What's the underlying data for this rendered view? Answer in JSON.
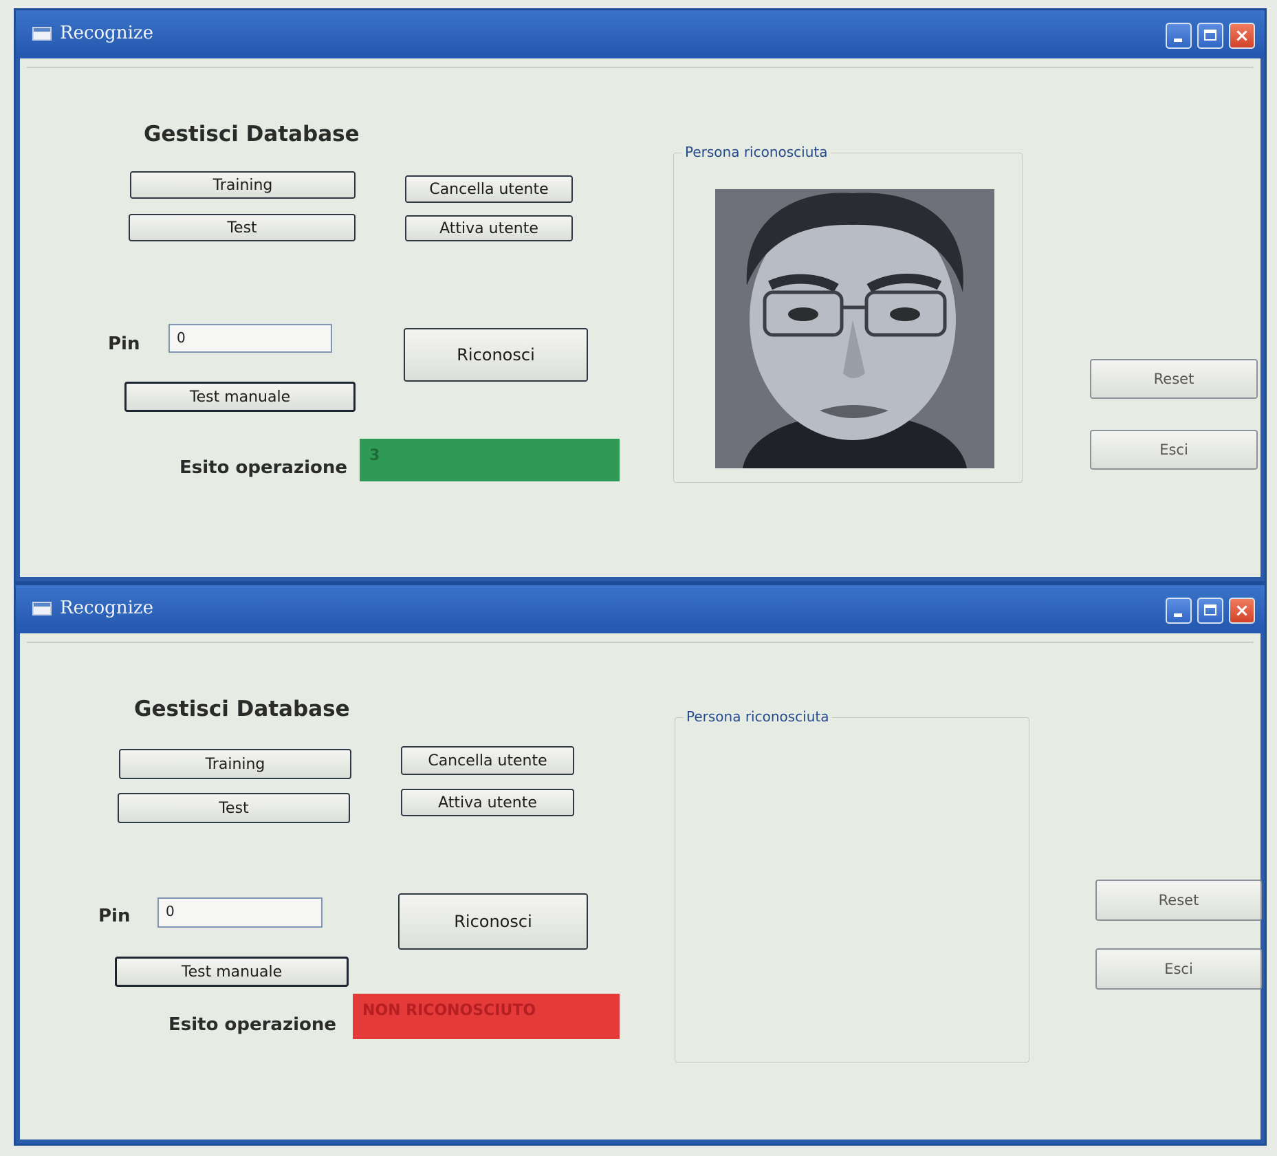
{
  "windows": [
    {
      "title": "Recognize",
      "close_symbol": "×",
      "heading": "Gestisci Database",
      "buttons": {
        "training": "Training",
        "test": "Test",
        "cancella": "Cancella utente",
        "attiva": "Attiva utente",
        "riconosci": "Riconosci",
        "test_manuale": "Test manuale",
        "reset": "Reset",
        "esci": "Esci"
      },
      "pin_label": "Pin",
      "pin_value": "0",
      "esito_label": "Esito operazione",
      "esito_value": "3",
      "esito_color": "#2f9a55",
      "group_title": "Persona riconosciuta",
      "face_shown": true
    },
    {
      "title": "Recognize",
      "close_symbol": "×",
      "heading": "Gestisci Database",
      "buttons": {
        "training": "Training",
        "test": "Test",
        "cancella": "Cancella utente",
        "attiva": "Attiva utente",
        "riconosci": "Riconosci",
        "test_manuale": "Test manuale",
        "reset": "Reset",
        "esci": "Esci"
      },
      "pin_label": "Pin",
      "pin_value": "0",
      "esito_label": "Esito operazione",
      "esito_value": "NON RICONOSCIUTO",
      "esito_color": "#e53a3a",
      "group_title": "Persona riconosciuta",
      "face_shown": false
    }
  ]
}
